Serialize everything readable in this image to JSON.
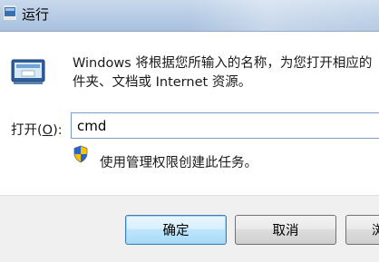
{
  "window": {
    "title": "运行",
    "app_icon": "run-app-icon",
    "accent_color": "#b6cbe4"
  },
  "main": {
    "run_icon": "run-dialog-icon",
    "description_line1": "Windows 将根据您所输入的名称，为您打开相应的",
    "description_line2": "件夹、文档或 Internet 资源。",
    "open_label_prefix": "打开(",
    "open_label_key": "O",
    "open_label_suffix": "):",
    "command_value": "cmd",
    "admin_icon": "uac-shield-icon",
    "admin_text": "使用管理权限创建此任务。"
  },
  "buttons": {
    "ok_label": "确定",
    "cancel_label": "取消",
    "browse_label": "浏"
  }
}
